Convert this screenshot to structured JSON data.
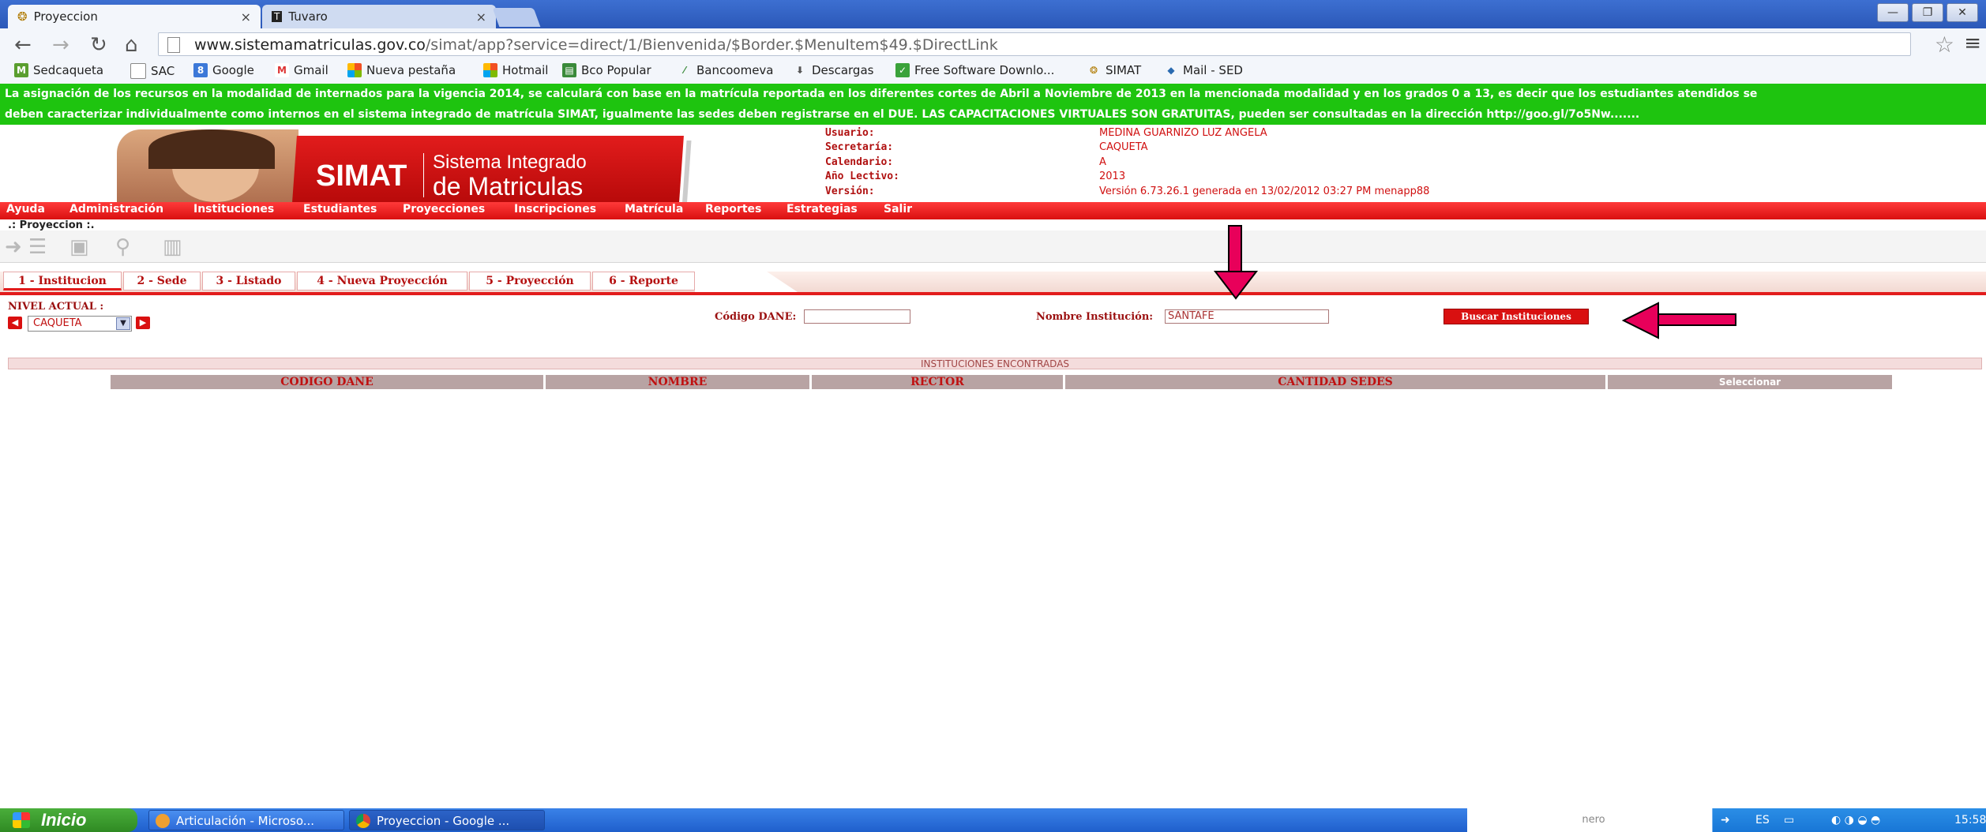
{
  "browser": {
    "tabs": [
      {
        "title": "Proyeccion",
        "close": "×"
      },
      {
        "title": "Tuvaro",
        "close": "×"
      }
    ],
    "url_host": "www.sistemamatriculas.gov.co",
    "url_path": "/simat/app?service=direct/1/Bienvenida/$Border.$MenuItem$49.$DirectLink",
    "bookmarks": [
      "Sedcaqueta",
      "SAC",
      "Google",
      "Gmail",
      "Nueva pestaña",
      "Hotmail",
      "Bco Popular",
      "Bancoomeva",
      "Descargas",
      "Free Software Downlo...",
      "SIMAT",
      "Mail - SED"
    ]
  },
  "banner": {
    "line1": "La asignación de los recursos en la modalidad de internados para la vigencia 2014, se calculará con base en la matrícula reportada en los diferentes cortes de Abril a Noviembre de 2013 en la mencionada modalidad y en los grados 0 a 13, es decir que los estudiantes atendidos se",
    "line2": "deben caracterizar individualmente como internos en el sistema integrado de matrícula SIMAT, igualmente las sedes deben registrarse en el DUE. LAS CAPACITACIONES VIRTUALES SON GRATUITAS, pueden ser consultadas en la dirección http://goo.gl/7o5Nw......."
  },
  "logo": {
    "word": "SIMAT",
    "sub1": "Sistema Integrado",
    "sub2": "de Matriculas"
  },
  "session": {
    "labels": [
      "Usuario:",
      "Secretaría:",
      "Calendario:",
      "Año Lectivo:",
      "Versión:"
    ],
    "values": [
      "MEDINA GUARNIZO LUZ ANGELA",
      "CAQUETA",
      "A",
      "2013",
      "Versión 6.73.26.1 generada en 13/02/2012 03:27 PM menapp88"
    ]
  },
  "menu": [
    "Ayuda",
    "Administración",
    "Instituciones",
    "Estudiantes",
    "Proyecciones",
    "Inscripciones",
    "Matrícula",
    "Reportes",
    "Estrategias",
    "Salir"
  ],
  "breadcrumb": ".: Proyeccion :.",
  "steps": [
    "1 - Institucion",
    "2 - Sede",
    "3 - Listado",
    "4 - Nueva Proyección",
    "5 - Proyección",
    "6 - Reporte"
  ],
  "form": {
    "nivel_label": "NIVEL ACTUAL :",
    "nivel_value": "CAQUETA",
    "dane_label": "Código DANE:",
    "dane_value": "",
    "nombre_label": "Nombre Institución:",
    "nombre_value": "SANTAFE",
    "search_button": "Buscar Instituciones"
  },
  "results": {
    "title": "INSTITUCIONES ENCONTRADAS",
    "columns": [
      "CODIGO DANE",
      "NOMBRE",
      "RECTOR",
      "CANTIDAD SEDES",
      "Seleccionar"
    ],
    "rows": []
  },
  "taskbar": {
    "start": "Inicio",
    "tasks": [
      "Articulación - Microso...",
      "Proyeccion - Google ..."
    ],
    "nero": "nero",
    "lang": "ES",
    "time": "15:58"
  },
  "colors": {
    "brand_red": "#d91010",
    "banner_green": "#1ec40f",
    "arrow_pink": "#e8005a"
  }
}
